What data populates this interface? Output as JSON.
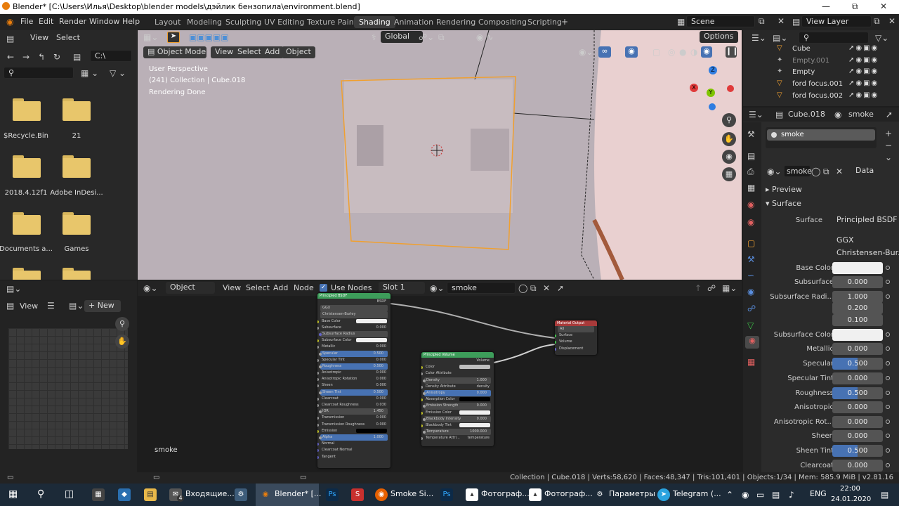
{
  "titlebar": {
    "title": "Blender* [C:\\Users\\Илья\\Desktop\\blender models\\дэйлик бензопила\\environment.blend]"
  },
  "menu": [
    "File",
    "Edit",
    "Render",
    "Window",
    "Help"
  ],
  "workspaces": [
    "Layout",
    "Modeling",
    "Sculpting",
    "UV Editing",
    "Texture Paint",
    "Shading",
    "Animation",
    "Rendering",
    "Compositing",
    "Scripting"
  ],
  "active_workspace": "Shading",
  "scene": {
    "scene_name": "Scene",
    "view_layer": "View Layer"
  },
  "file_browser": {
    "view_label": "View",
    "select_label": "Select",
    "path": "C:\\",
    "folders": [
      "$Recycle.Bin",
      "21",
      "2018.4.12f1",
      "Adobe InDesi...",
      "Documents a...",
      "Games"
    ]
  },
  "viewport": {
    "transform": "Global",
    "options": "Options",
    "mode": "Object Mode",
    "menus": [
      "View",
      "Select",
      "Add",
      "Object"
    ],
    "info1": "User Perspective",
    "info2": "(241) Collection | Cube.018",
    "info3": "Rendering Done",
    "gizmo": {
      "z": "Z",
      "y": "Y",
      "x": "X"
    }
  },
  "node_editor": {
    "editor_type": "Object",
    "menus": [
      "View",
      "Select",
      "Add",
      "Node"
    ],
    "use_nodes": "Use Nodes",
    "slot": "Slot 1",
    "material": "smoke",
    "label": "smoke",
    "bsdf_node": {
      "title": "Principled BSDF",
      "output": "BSDF",
      "rows": [
        {
          "label": "GGX",
          "value": ""
        },
        {
          "label": "Christensen-Burley",
          "value": ""
        },
        {
          "label": "Base Color",
          "value": ""
        },
        {
          "label": "Subsurface",
          "value": "0.000"
        },
        {
          "label": "Subsurface Radius",
          "value": ""
        },
        {
          "label": "Subsurface Color",
          "value": ""
        },
        {
          "label": "Metallic",
          "value": "0.000"
        },
        {
          "label": "Specular",
          "value": "0.500"
        },
        {
          "label": "Specular Tint",
          "value": "0.000"
        },
        {
          "label": "Roughness",
          "value": "0.500"
        },
        {
          "label": "Anisotropic",
          "value": "0.000"
        },
        {
          "label": "Anisotropic Rotation",
          "value": "0.000"
        },
        {
          "label": "Sheen",
          "value": "0.000"
        },
        {
          "label": "Sheen Tint",
          "value": "0.500"
        },
        {
          "label": "Clearcoat",
          "value": "0.000"
        },
        {
          "label": "Clearcoat Roughness",
          "value": "0.030"
        },
        {
          "label": "IOR",
          "value": "1.450"
        },
        {
          "label": "Transmission",
          "value": "0.000"
        },
        {
          "label": "Transmission Roughness",
          "value": "0.000"
        },
        {
          "label": "Emission",
          "value": ""
        },
        {
          "label": "Alpha",
          "value": "1.000"
        },
        {
          "label": "Normal",
          "value": ""
        },
        {
          "label": "Clearcoat Normal",
          "value": ""
        },
        {
          "label": "Tangent",
          "value": ""
        }
      ]
    },
    "volume_node": {
      "title": "Principled Volume",
      "output": "Volume",
      "rows": [
        {
          "label": "Color",
          "value": ""
        },
        {
          "label": "Color Attribute",
          "value": ""
        },
        {
          "label": "Density",
          "value": "1.000"
        },
        {
          "label": "Density Attribute",
          "value": "density"
        },
        {
          "label": "Anisotropy",
          "value": "0.000"
        },
        {
          "label": "Absorption Color",
          "value": ""
        },
        {
          "label": "Emission Strength",
          "value": "0.000"
        },
        {
          "label": "Emission Color",
          "value": ""
        },
        {
          "label": "Blackbody Intensity",
          "value": "0.000"
        },
        {
          "label": "Blackbody Tint",
          "value": ""
        },
        {
          "label": "Temperature",
          "value": "1000.000"
        },
        {
          "label": "Temperature Attri...",
          "value": "temperature"
        }
      ]
    },
    "output_node": {
      "title": "Material Output",
      "target": "All",
      "rows": [
        "Surface",
        "Volume",
        "Displacement"
      ]
    }
  },
  "image_panel": {
    "view_label": "View",
    "new_label": "New"
  },
  "outliner": {
    "items": [
      "Cube",
      "Empty.001",
      "Empty",
      "ford focus.001",
      "ford focus.002"
    ]
  },
  "properties": {
    "object": "Cube.018",
    "material": "smoke",
    "slot_name": "smoke",
    "datablock": "smoke",
    "link": "Data",
    "preview_label": "Preview",
    "surface_label": "Surface",
    "surface_shader_label": "Surface",
    "surface_shader": "Principled BSDF",
    "distribution": "GGX",
    "subsurface_method": "Christensen-Bur...",
    "rows": [
      {
        "label": "Base Color",
        "value": "",
        "kind": "white"
      },
      {
        "label": "Subsurface",
        "value": "0.000",
        "kind": "num"
      },
      {
        "label": "Subsurface Radi...",
        "value": "1.000",
        "kind": "num"
      },
      {
        "label": "",
        "value": "0.200",
        "kind": "num"
      },
      {
        "label": "",
        "value": "0.100",
        "kind": "num"
      },
      {
        "label": "Subsurface Color",
        "value": "",
        "kind": "white"
      },
      {
        "label": "Metallic",
        "value": "0.000",
        "kind": "num"
      },
      {
        "label": "Specular",
        "value": "0.500",
        "kind": "blue"
      },
      {
        "label": "Specular Tint",
        "value": "0.000",
        "kind": "num"
      },
      {
        "label": "Roughness",
        "value": "0.500",
        "kind": "blue"
      },
      {
        "label": "Anisotropic",
        "value": "0.000",
        "kind": "num"
      },
      {
        "label": "Anisotropic Rot...",
        "value": "0.000",
        "kind": "num"
      },
      {
        "label": "Sheen",
        "value": "0.000",
        "kind": "num"
      },
      {
        "label": "Sheen Tint",
        "value": "0.500",
        "kind": "blue"
      },
      {
        "label": "Clearcoat",
        "value": "0.000",
        "kind": "num"
      }
    ]
  },
  "statusbar": {
    "text": "Collection | Cube.018 | Verts:58,620 | Faces:48,347 | Tris:101,401 | Objects:1/34 | Mem: 585.9 MiB | v2.81.16"
  },
  "taskbar": {
    "items": [
      "Входящие...",
      "Blender* [...",
      "Smoke Si...",
      "Фотограф...",
      "Фотограф...",
      "Параметры",
      "Telegram (..."
    ],
    "badge": "4",
    "lang": "ENG",
    "time": "22:00",
    "date": "24.01.2020"
  }
}
